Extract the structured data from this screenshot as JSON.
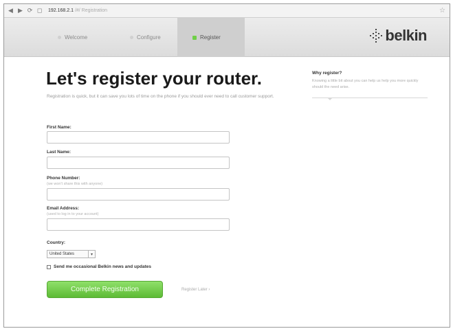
{
  "browser": {
    "url_host": "192.168.2.1",
    "url_path": "/#/ Registration"
  },
  "steps": [
    {
      "label": "Welcome"
    },
    {
      "label": "Configure"
    },
    {
      "label": "Register"
    }
  ],
  "brand": {
    "name": "belkin",
    "accent_color": "#6fcf47"
  },
  "main": {
    "title": "Let's register your router.",
    "subtitle": "Registration is quick, but it can save you lots of time on the phone if you should ever need to call customer support."
  },
  "form": {
    "first_name": {
      "label": "First Name:",
      "value": ""
    },
    "last_name": {
      "label": "Last Name:",
      "value": ""
    },
    "phone": {
      "label": "Phone Number:",
      "hint": "(we won't share this with anyone)",
      "value": ""
    },
    "email": {
      "label": "Email Address:",
      "hint": "(used to log in to your account)",
      "value": ""
    },
    "country": {
      "label": "Country:",
      "selected": "United States"
    },
    "optin": {
      "label": "Send me occasional Belkin news and updates",
      "checked": false
    },
    "submit_label": "Complete Registration",
    "later_label": "Register Later ›"
  },
  "sidebar": {
    "title": "Why register?",
    "text": "Knowing a little bit about you can help us help you more quickly should the need arise."
  }
}
